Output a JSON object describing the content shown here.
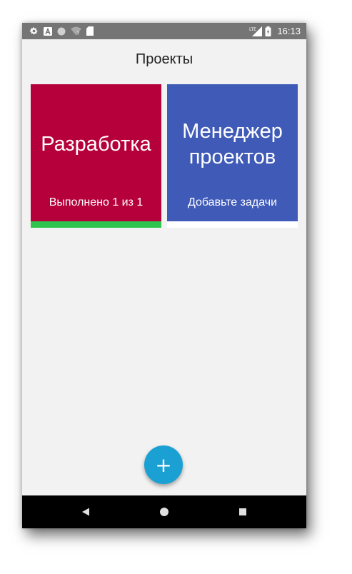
{
  "status_bar": {
    "time": "16:13",
    "network_label": "LTE",
    "icons": [
      "gear-icon",
      "a-badge-icon",
      "circle-icon",
      "wifi-question-icon",
      "sd-card-icon",
      "signal-icon",
      "battery-icon"
    ]
  },
  "toolbar": {
    "title": "Проекты"
  },
  "projects": [
    {
      "name": "Разработка",
      "status": "Выполнено 1 из 1",
      "color": "#b5003c",
      "progress": 1.0
    },
    {
      "name_line1": "Менеджер",
      "name_line2": "проектов",
      "status": "Добавьте задачи",
      "color": "#3f5ab7",
      "progress": 0
    }
  ],
  "fab": {
    "label": "+",
    "color": "#1aa0d3"
  },
  "colors": {
    "progress": "#2fc44d",
    "background": "#f2f2f2",
    "status_bar": "#757575"
  },
  "nav_bar": {
    "icons": [
      "back-icon",
      "home-icon",
      "recents-icon"
    ]
  }
}
